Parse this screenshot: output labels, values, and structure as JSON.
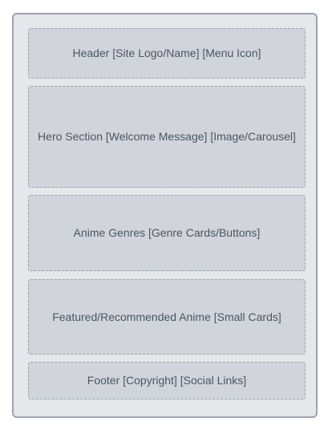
{
  "wireframe": {
    "sections": {
      "header": "Header [Site Logo/Name] [Menu Icon]",
      "hero": "Hero Section [Welcome Message] [Image/Carousel]",
      "genres": "Anime Genres [Genre Cards/Buttons]",
      "featured": "Featured/Recommended Anime [Small Cards]",
      "footer": "Footer [Copyright] [Social Links]"
    }
  }
}
